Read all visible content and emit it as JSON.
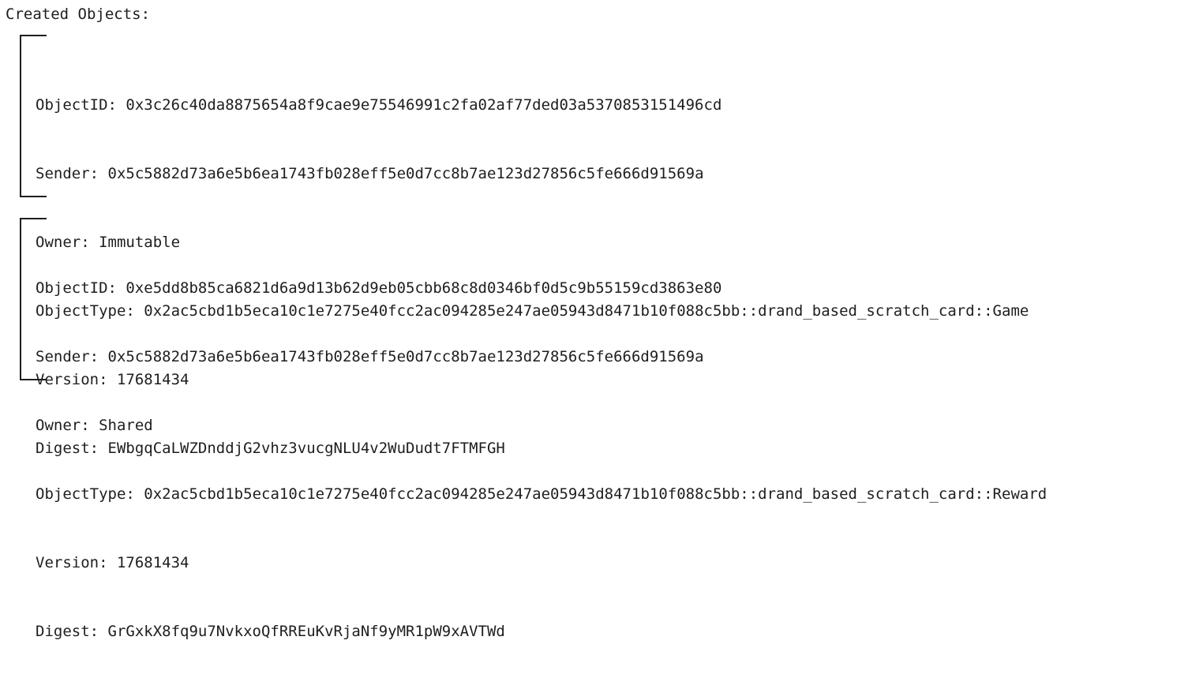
{
  "heading": "Created Objects:",
  "objects": [
    {
      "id_label": "ObjectID:",
      "id_value": "0x3c26c40da8875654a8f9cae9e75546991c2fa02af77ded03a5370853151496cd",
      "sender_label": "Sender:",
      "sender_value": "0x5c5882d73a6e5b6ea1743fb028eff5e0d7cc8b7ae123d27856c5fe666d91569a",
      "owner_label": "Owner:",
      "owner_value": "Immutable",
      "type_label": "ObjectType:",
      "type_value": "0x2ac5cbd1b5eca10c1e7275e40fcc2ac094285e247ae05943d8471b10f088c5bb::drand_based_scratch_card::Game",
      "version_label": "Version:",
      "version_value": "17681434",
      "digest_label": "Digest:",
      "digest_value": "EWbgqCaLWZDnddjG2vhz3vucgNLU4v2WuDudt7FTMFGH"
    },
    {
      "id_label": "ObjectID:",
      "id_value": "0xe5dd8b85ca6821d6a9d13b62d9eb05cbb68c8d0346bf0d5c9b55159cd3863e80",
      "sender_label": "Sender:",
      "sender_value": "0x5c5882d73a6e5b6ea1743fb028eff5e0d7cc8b7ae123d27856c5fe666d91569a",
      "owner_label": "Owner:",
      "owner_value": "Shared",
      "type_label": "ObjectType:",
      "type_value": "0x2ac5cbd1b5eca10c1e7275e40fcc2ac094285e247ae05943d8471b10f088c5bb::drand_based_scratch_card::Reward",
      "version_label": "Version:",
      "version_value": "17681434",
      "digest_label": "Digest:",
      "digest_value": "GrGxkX8fq9u7NvkxoQfRREuKvRjaNf9yMR1pW9xAVTWd"
    }
  ]
}
